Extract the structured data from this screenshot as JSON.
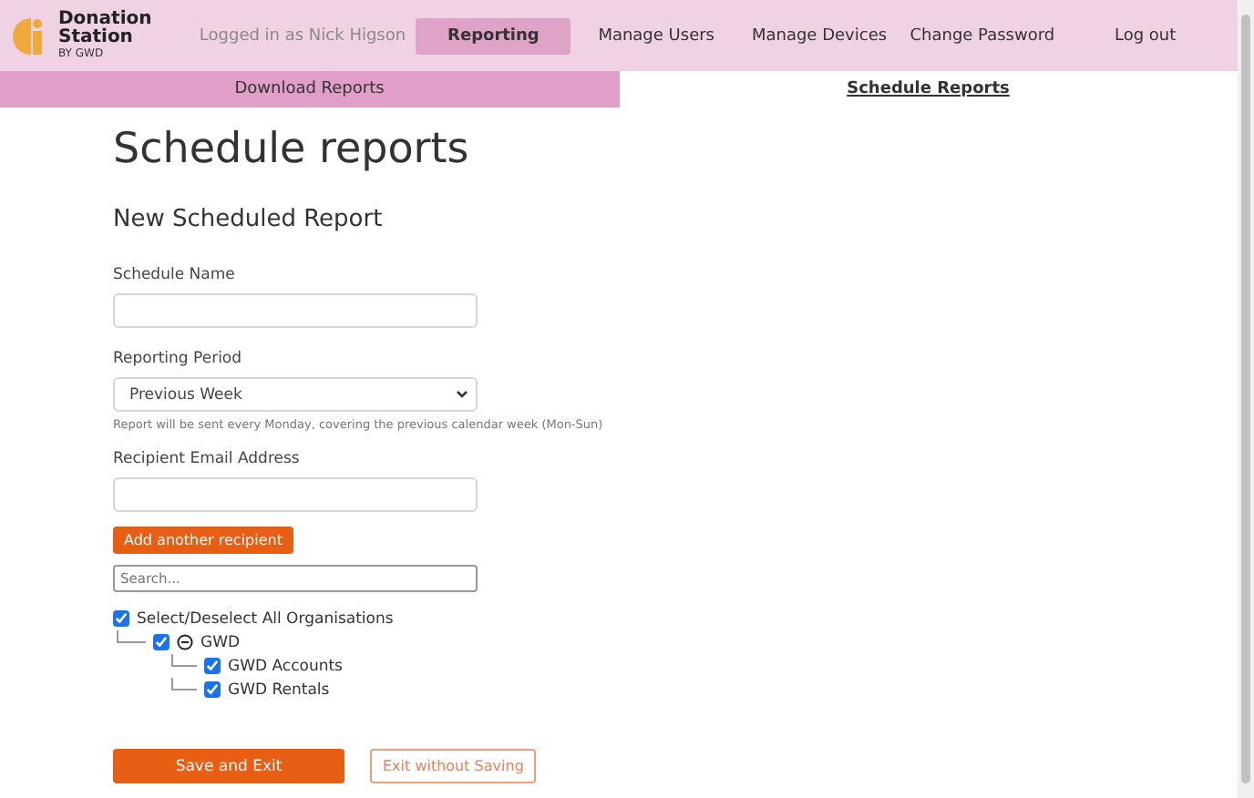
{
  "brand": {
    "name_line1": "Donation",
    "name_line2": "Station",
    "byline": "BY GWD"
  },
  "logged_in": "Logged in as Nick Higson",
  "nav": [
    {
      "label": "Reporting",
      "selected": true
    },
    {
      "label": "Manage Users",
      "selected": false
    },
    {
      "label": "Manage Devices",
      "selected": false
    },
    {
      "label": "Change Password",
      "selected": false
    },
    {
      "label": "Log out",
      "selected": false
    }
  ],
  "subtabs": [
    {
      "label": "Download Reports",
      "selected": false
    },
    {
      "label": "Schedule Reports",
      "selected": true
    }
  ],
  "title": "Schedule reports",
  "subtitle": "New Scheduled Report",
  "schedule_name": {
    "label": "Schedule Name"
  },
  "reporting_period": {
    "label": "Reporting Period",
    "value": "Previous Week",
    "hint": "Report will be sent every Monday, covering the previous calendar week (Mon-Sun)"
  },
  "recipient": {
    "label": "Recipient Email Address"
  },
  "add_recipient": "Add another recipient",
  "search": {
    "placeholder": "Search..."
  },
  "select_all": {
    "label": "Select/Deselect All Organisations",
    "checked": true
  },
  "organisations": [
    {
      "label": "GWD",
      "checked": true,
      "expanded": true,
      "children": [
        {
          "label": "GWD Accounts",
          "checked": true
        },
        {
          "label": "GWD Rentals",
          "checked": true
        }
      ]
    }
  ],
  "buttons": {
    "save": "Save and Exit",
    "exit": "Exit without Saving"
  }
}
